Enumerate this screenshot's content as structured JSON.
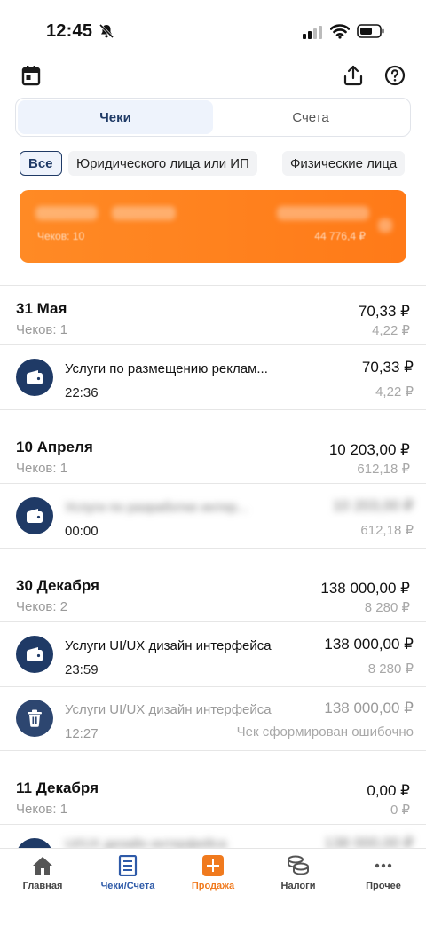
{
  "status_bar": {
    "time": "12:45"
  },
  "tabs": {
    "receipts": "Чеки",
    "invoices": "Счета"
  },
  "filters": [
    "Все",
    "Юридического лица или ИП",
    "Физические лица"
  ],
  "promo": {
    "count_label": "Чеков: 10",
    "total": "44 776,4 ₽"
  },
  "groups": [
    {
      "date": "31 Мая",
      "sum": "70,33 ₽",
      "count": "Чеков: 1",
      "tax": "4,22 ₽",
      "receipts": [
        {
          "title": "Услуги по размещению реклам...",
          "time": "22:36",
          "sum": "70,33 ₽",
          "tax": "4,22 ₽"
        }
      ]
    },
    {
      "date": "10 Апреля",
      "sum": "10 203,00 ₽",
      "count": "Чеков: 1",
      "tax": "612,18 ₽",
      "receipts": [
        {
          "title": "Услуги по разработке интер...",
          "time": "00:00",
          "sum": "10 203,00 ₽",
          "tax": "612,18 ₽"
        }
      ]
    },
    {
      "date": "30 Декабря",
      "sum": "138 000,00 ₽",
      "count": "Чеков: 2",
      "tax": "8 280 ₽",
      "receipts": [
        {
          "title": "Услуги UI/UX дизайн интерфейса",
          "time": "23:59",
          "sum": "138 000,00 ₽",
          "tax": "8 280 ₽"
        },
        {
          "title": "Услуги UI/UX дизайн интерфейса",
          "time": "12:27",
          "sum": "138 000,00 ₽",
          "status": "Чек сформирован ошибочно"
        }
      ]
    },
    {
      "date": "11 Декабря",
      "sum": "0,00 ₽",
      "count": "Чеков: 1",
      "tax": "0 ₽",
      "receipts": [
        {
          "title": "UI/UX дизайн интерфейса",
          "sum": "138 000,00 ₽"
        }
      ]
    }
  ],
  "bottom_nav": {
    "home": "Главная",
    "receipts": "Чеки/Счета",
    "sale": "Продажа",
    "taxes": "Налоги",
    "more": "Прочее"
  },
  "colors": {
    "primary": "#1f3a66",
    "accent": "#ff7a18",
    "active_nav": "#2e5aa8"
  }
}
